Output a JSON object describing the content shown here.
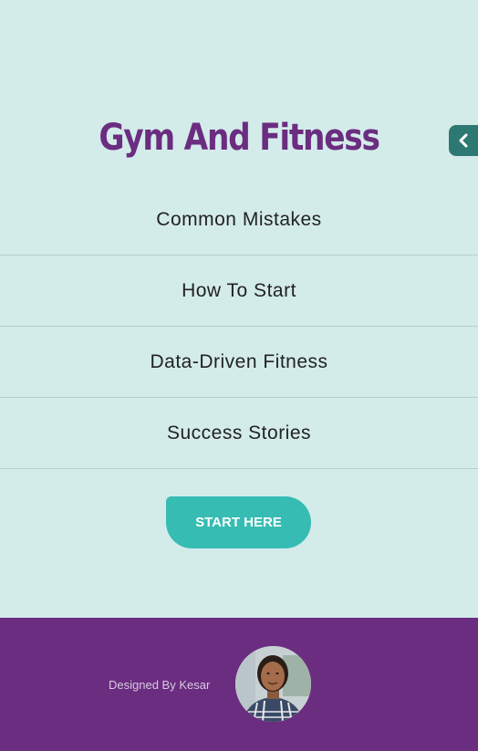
{
  "header": {
    "title": "Gym And Fitness"
  },
  "menu": {
    "items": [
      {
        "label": "Common Mistakes"
      },
      {
        "label": "How To Start"
      },
      {
        "label": "Data-Driven Fitness"
      },
      {
        "label": "Success Stories"
      }
    ]
  },
  "cta": {
    "label": "START HERE"
  },
  "footer": {
    "credit": "Designed By Kesar"
  },
  "colors": {
    "background": "#d3ecea",
    "brand_purple": "#6b2d80",
    "accent_teal": "#36bcb3",
    "tab_teal": "#2e7873"
  },
  "icons": {
    "collapse": "chevron-left-icon"
  }
}
